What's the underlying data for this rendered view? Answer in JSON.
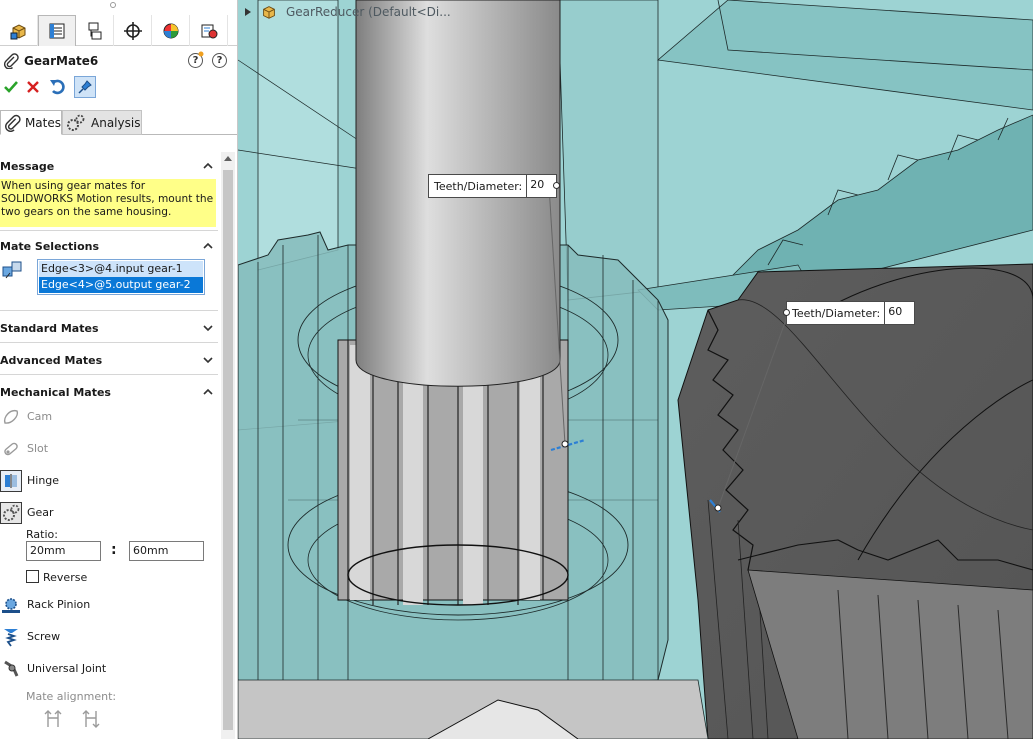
{
  "tree": {
    "label": "GearReducer  (Default<Di..."
  },
  "property_manager": {
    "title": "GearMate6",
    "tabs": [
      "Mates",
      "Analysis"
    ],
    "sections": {
      "message": {
        "title": "Message",
        "text": "When using gear mates for SOLIDWORKS Motion results, mount the two gears on the same housing."
      },
      "mate_selections": {
        "title": "Mate Selections",
        "items": [
          "Edge<3>@4.input gear-1",
          "Edge<4>@5.output gear-2"
        ]
      },
      "standard_mates": {
        "title": "Standard Mates"
      },
      "advanced_mates": {
        "title": "Advanced Mates"
      },
      "mechanical_mates": {
        "title": "Mechanical Mates",
        "items": [
          "Cam",
          "Slot",
          "Hinge",
          "Gear",
          "Rack Pinion",
          "Screw",
          "Universal Joint"
        ],
        "ratio_label": "Ratio:",
        "ratio_sep": ":",
        "ratio_values": [
          "20mm",
          "60mm"
        ],
        "reverse_label": "Reverse",
        "alignment_label": "Mate alignment:"
      }
    }
  },
  "callouts": [
    {
      "label": "Teeth/Diameter:",
      "value": "20"
    },
    {
      "label": "Teeth/Diameter:",
      "value": "60"
    }
  ],
  "colors": {
    "accent_blue": "#0a78d7",
    "message_yellow": "#ffff88",
    "housing_teal": "#8fc9c9",
    "gear_grey": "#6e6e6e"
  }
}
